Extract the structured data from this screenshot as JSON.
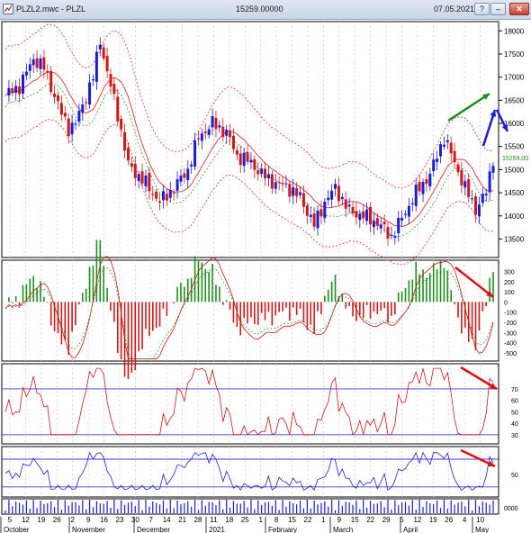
{
  "window": {
    "title": "PLZL2.mwc - PLZL",
    "price": "15259.00000",
    "date": "07.05.2021",
    "buttons": {
      "help": "?",
      "minimize": "–",
      "maximize": "□",
      "close": "✕"
    }
  },
  "colors": {
    "bull": "#1b1bd8",
    "bear": "#d01818",
    "hist_up": "#1e8f1e",
    "hist_down": "#d01818",
    "envelope": "#e03030",
    "rsi": "#d01818",
    "osc": "#2222cc",
    "hline": "#3a3ad0",
    "arrow_green": "#1e8f1e",
    "arrow_blue": "#1b1bd8",
    "arrow_red": "#e01010"
  },
  "price_axis": {
    "ticks": [
      "18000",
      "17500",
      "17000",
      "16500",
      "16000",
      "15500",
      "15000",
      "14500",
      "14000",
      "13500"
    ],
    "min": 13100,
    "max": 18200,
    "last": "15259.00"
  },
  "macd_axis": {
    "ticks": [
      "300",
      "200",
      "100",
      "0",
      "-100",
      "-200",
      "-300",
      "-400",
      "-500"
    ],
    "min": -580,
    "max": 410
  },
  "rsi_axis": {
    "ticks": [
      "70",
      "60",
      "50",
      "40",
      "30"
    ],
    "min": 22,
    "max": 92,
    "levels": [
      70,
      30
    ]
  },
  "osc_axis": {
    "ticks": [
      "50"
    ],
    "min": 0,
    "max": 100,
    "levels": [
      75,
      20
    ]
  },
  "vol_axis": {
    "ticks": [
      "0000"
    ]
  },
  "day_labels": [
    "5",
    "12",
    "19",
    "26",
    "2",
    "9",
    "16",
    "23",
    "30",
    "7",
    "14",
    "21",
    "28",
    "11",
    "18",
    "25",
    "1",
    "8",
    "15",
    "22",
    "1",
    "9",
    "15",
    "22",
    "29",
    "5",
    "12",
    "19",
    "26",
    "4",
    "10"
  ],
  "month_labels": [
    "October",
    "November",
    "December",
    "2021",
    "February",
    "March",
    "April",
    "May"
  ],
  "chart_data": {
    "type": "candlestick",
    "price_anchors": [
      [
        0,
        16600
      ],
      [
        4,
        16800
      ],
      [
        8,
        17400
      ],
      [
        11,
        17200
      ],
      [
        16,
        16200
      ],
      [
        18,
        15900
      ],
      [
        20,
        16000
      ],
      [
        25,
        17000
      ],
      [
        27,
        17800
      ],
      [
        29,
        17100
      ],
      [
        32,
        16200
      ],
      [
        35,
        15100
      ],
      [
        40,
        14700
      ],
      [
        44,
        14300
      ],
      [
        48,
        14600
      ],
      [
        52,
        15000
      ],
      [
        55,
        15700
      ],
      [
        59,
        16000
      ],
      [
        63,
        15800
      ],
      [
        66,
        15300
      ],
      [
        70,
        15150
      ],
      [
        73,
        14900
      ],
      [
        77,
        14700
      ],
      [
        80,
        14650
      ],
      [
        84,
        14400
      ],
      [
        88,
        13800
      ],
      [
        91,
        14300
      ],
      [
        94,
        14600
      ],
      [
        98,
        14100
      ],
      [
        102,
        14000
      ],
      [
        106,
        13850
      ],
      [
        110,
        13550
      ],
      [
        113,
        13950
      ],
      [
        117,
        14500
      ],
      [
        121,
        14900
      ],
      [
        125,
        15700
      ],
      [
        128,
        15150
      ],
      [
        131,
        14600
      ],
      [
        134,
        14150
      ],
      [
        137,
        14500
      ],
      [
        139,
        15259
      ]
    ]
  }
}
